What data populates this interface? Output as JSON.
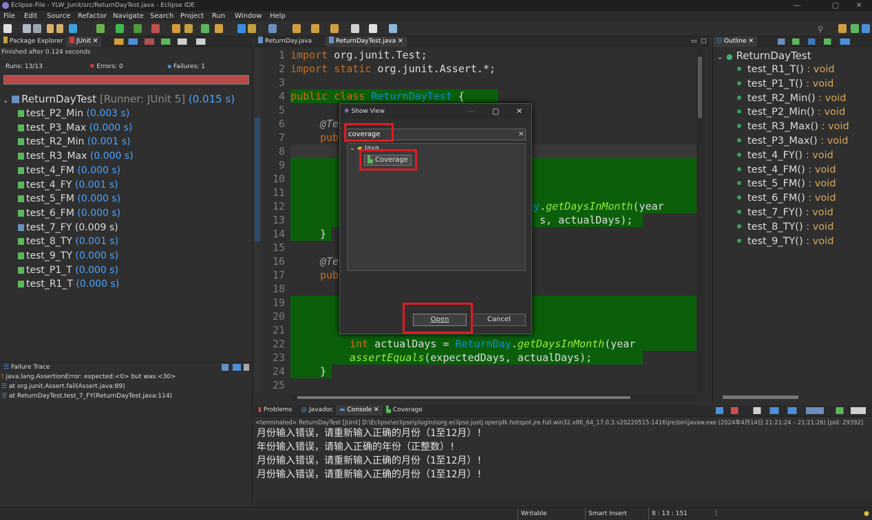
{
  "window": {
    "title": "Eclipse-File - YLW_Junit/src/ReturnDayTest.java - Eclipse IDE",
    "controls": [
      "—",
      "▢",
      "✕"
    ]
  },
  "menu": [
    "File",
    "Edit",
    "Source",
    "Refactor",
    "Navigate",
    "Search",
    "Project",
    "Run",
    "Window",
    "Help"
  ],
  "left_panel": {
    "tabs": [
      "Package Explorer",
      "JUnit"
    ],
    "finished": "Finished after 0.124 seconds",
    "runs_label": "Runs:",
    "runs": "13/13",
    "errors_label": "Errors:",
    "errors": "0",
    "failures_label": "Failures:",
    "failures": "1",
    "progress_fraction": 1.0,
    "root": {
      "name": "ReturnDayTest",
      "runner": "[Runner: JUnit 5]",
      "time": "(0.015 s)"
    },
    "tests": [
      {
        "name": "test_P2_Min",
        "time": "(0.003 s)",
        "fail": false
      },
      {
        "name": "test_P3_Max",
        "time": "(0.000 s)",
        "fail": false
      },
      {
        "name": "test_R2_Min",
        "time": "(0.001 s)",
        "fail": false
      },
      {
        "name": "test_R3_Max",
        "time": "(0.000 s)",
        "fail": false
      },
      {
        "name": "test_4_FM",
        "time": "(0.000 s)",
        "fail": false
      },
      {
        "name": "test_4_FY",
        "time": "(0.001 s)",
        "fail": false
      },
      {
        "name": "test_5_FM",
        "time": "(0.000 s)",
        "fail": false
      },
      {
        "name": "test_6_FM",
        "time": "(0.000 s)",
        "fail": false
      },
      {
        "name": "test_7_FY",
        "time": "(0.009 s)",
        "fail": true
      },
      {
        "name": "test_8_TY",
        "time": "(0.001 s)",
        "fail": false
      },
      {
        "name": "test_9_TY",
        "time": "(0.000 s)",
        "fail": false
      },
      {
        "name": "test_P1_T",
        "time": "(0.000 s)",
        "fail": false
      },
      {
        "name": "test_R1_T",
        "time": "(0.000 s)",
        "fail": false
      }
    ],
    "failure_trace_title": "Failure Trace",
    "trace": [
      "java.lang.AssertionError: expected:<0> but was:<30>",
      "at org.junit.Assert.fail(Assert.java:89)",
      "at ReturnDayTest.test_7_FY(ReturnDayTest.java:114)"
    ]
  },
  "editor": {
    "tabs": [
      "ReturnDay.java",
      "ReturnDayTest.java"
    ],
    "line_numbers": [
      "1",
      "2",
      "3",
      "4",
      "5",
      "6",
      "7",
      "8",
      "9",
      "10",
      "11",
      "12",
      "13",
      "14",
      "15",
      "16",
      "17",
      "18",
      "19",
      "20",
      "21",
      "22",
      "23",
      "24",
      "25"
    ],
    "code": {
      "l1": {
        "kw": "import",
        "rest": " org.junit.Test;"
      },
      "l2": {
        "kw": "import static",
        "rest": " org.junit.Assert.*;"
      },
      "l4": {
        "kw": "public class",
        "cls": " ReturnDayTest",
        "rest": " {"
      },
      "l6": "@Te",
      "l7": "pub",
      "l12": {
        "cls": "ay",
        "rest": ".",
        "mth": "getDaysInMonth",
        "end": "(year"
      },
      "l13": "s, actualDays);",
      "l14": "}",
      "l16": "@Te",
      "l17": "pub",
      "l22": {
        "kw": "int",
        "rest": " actualDays = ",
        "cls": "ReturnDay",
        "dot": ".",
        "mth": "getDaysInMonth",
        "end": "(year"
      },
      "l23": {
        "mth": "assertEquals",
        "rest": "(expectedDays, actualDays);"
      },
      "l24": "}"
    }
  },
  "outline": {
    "tab": "Outline",
    "root": "ReturnDayTest",
    "items": [
      {
        "name": "test_R1_T()",
        "type": " : void"
      },
      {
        "name": "test_P1_T()",
        "type": " : void"
      },
      {
        "name": "test_R2_Min()",
        "type": " : void"
      },
      {
        "name": "test_P2_Min()",
        "type": " : void"
      },
      {
        "name": "test_R3_Max()",
        "type": " : void"
      },
      {
        "name": "test_P3_Max()",
        "type": " : void"
      },
      {
        "name": "test_4_FY()",
        "type": " : void"
      },
      {
        "name": "test_4_FM()",
        "type": " : void"
      },
      {
        "name": "test_5_FM()",
        "type": " : void"
      },
      {
        "name": "test_6_FM()",
        "type": " : void"
      },
      {
        "name": "test_7_FY()",
        "type": " : void"
      },
      {
        "name": "test_8_TY()",
        "type": " : void"
      },
      {
        "name": "test_9_TY()",
        "type": " : void"
      }
    ]
  },
  "console": {
    "tabs": [
      "Problems",
      "Javadoc",
      "Console",
      "Coverage"
    ],
    "terminated": "<terminated> ReturnDayTest [JUnit] D:\\Eclipse\\eclipse\\plugins\\org.eclipse.justj.openjdk.hotspot.jre.full.win32.x86_64_17.0.3.v20220515-1416\\jre\\bin\\javaw.exe  (2024年4月14日 21:21:24 – 21:21:26) [pid: 29392]",
    "lines": [
      "月份输入错误，请重新输入正确的月份（1至12月）!",
      "年份输入错误，请输入正确的年份（正整数）!",
      "月份输入错误，请重新输入正确的月份（1至12月）!",
      "月份输入错误，请重新输入正确的月份（1至12月）!"
    ]
  },
  "dialog": {
    "title": "Show View",
    "search_value": "coverage",
    "category": "Java",
    "item": "Coverage",
    "open": "Open",
    "cancel": "Cancel"
  },
  "status": {
    "writable": "Writable",
    "insert": "Smart Insert",
    "position": "8 : 13 : 151"
  },
  "colors": {
    "accent_red": "#e01b24",
    "junit_bar": "#b94a4a",
    "highlight_green": "#0b5f0b"
  }
}
